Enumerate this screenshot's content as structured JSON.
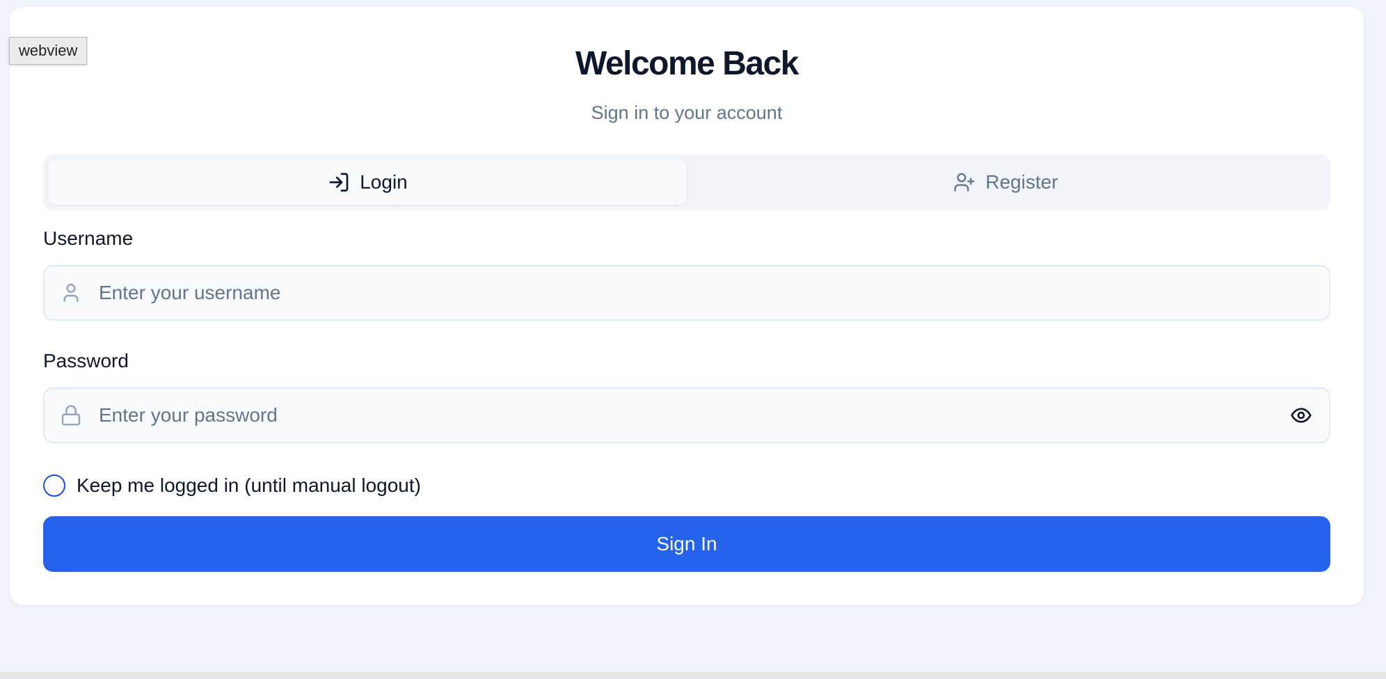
{
  "webview_label": "webview",
  "header": {
    "title": "Welcome Back",
    "subtitle": "Sign in to your account"
  },
  "tabs": [
    {
      "label": "Login",
      "icon": "log-in-icon",
      "active": true
    },
    {
      "label": "Register",
      "icon": "user-plus-icon",
      "active": false
    }
  ],
  "form": {
    "username": {
      "label": "Username",
      "placeholder": "Enter your username",
      "value": "",
      "icon": "user-icon"
    },
    "password": {
      "label": "Password",
      "placeholder": "Enter your password",
      "value": "",
      "icon": "lock-icon",
      "toggle_icon": "eye-icon"
    },
    "remember_label": "Keep me logged in (until manual logout)",
    "remember_checked": false,
    "submit_label": "Sign In"
  },
  "colors": {
    "accent": "#2563eb",
    "page_bg": "#f0f4fb",
    "card_bg": "#ffffff",
    "text_primary": "#0f172a",
    "text_muted": "#64748b"
  }
}
